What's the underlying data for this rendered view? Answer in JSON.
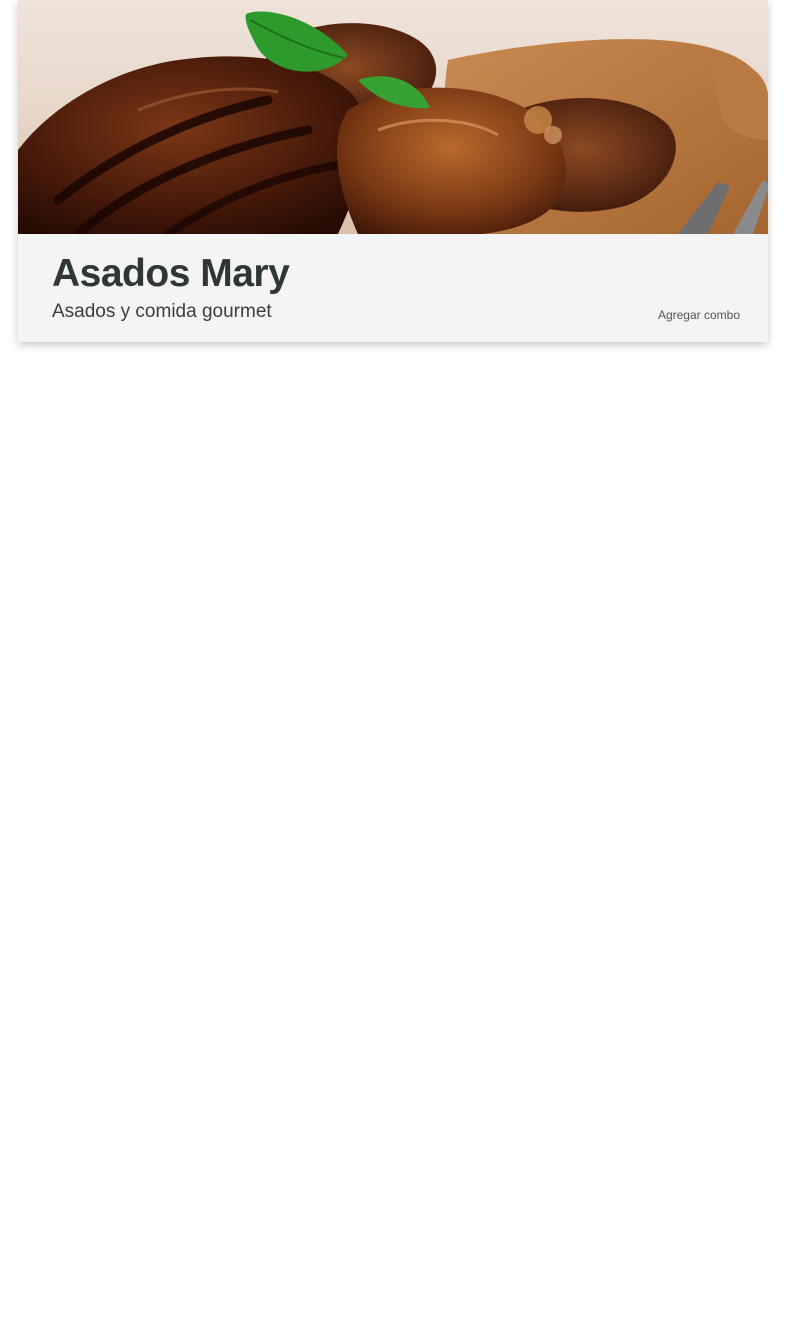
{
  "restaurant": {
    "name": "Asados Mary",
    "tagline": "Asados y comida gourmet",
    "hero_image": "grilled-meat-photo"
  },
  "actions": {
    "add_combo_label": "Agregar combo"
  },
  "colors": {
    "card_background": "#f4f4f4",
    "title_color": "#2e3733",
    "subtitle_color": "#3d3d3d",
    "link_color": "#555555"
  }
}
